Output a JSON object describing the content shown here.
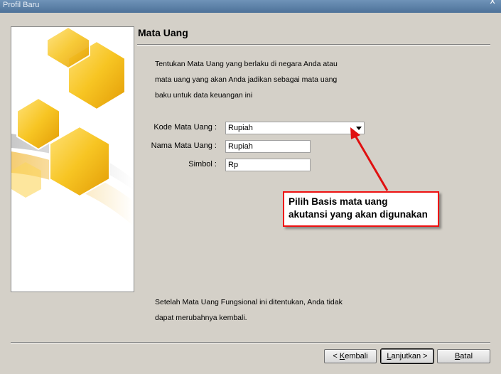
{
  "window": {
    "title": "Profil Baru",
    "close_glyph": "x"
  },
  "panel": {
    "title": "Mata Uang",
    "description": [
      "Tentukan Mata Uang yang berlaku di negara Anda atau",
      "mata uang yang akan Anda jadikan sebagai mata uang",
      "baku untuk data keuangan ini"
    ],
    "fields": {
      "currency_code_label": "Kode Mata Uang :",
      "currency_code_value": "Rupiah",
      "currency_name_label": "Nama Mata Uang :",
      "currency_name_value": "Rupiah",
      "symbol_label": "Simbol :",
      "symbol_value": "Rp"
    },
    "note": [
      "Setelah Mata Uang Fungsional ini ditentukan, Anda tidak",
      "dapat merubahnya kembali."
    ]
  },
  "callout": {
    "line1": "Pilih Basis mata uang",
    "line2": "akutansi yang akan digunakan"
  },
  "buttons": {
    "back": {
      "prefix": "< ",
      "accel": "K",
      "rest": "embali"
    },
    "next": {
      "accel": "L",
      "rest": "anjutkan >"
    },
    "cancel": {
      "accel": "B",
      "rest": "atal"
    }
  },
  "colors": {
    "accent_red": "#e01010",
    "hexagon_yellow": "#f5c21a",
    "dialog_bg": "#d4d0c8"
  }
}
